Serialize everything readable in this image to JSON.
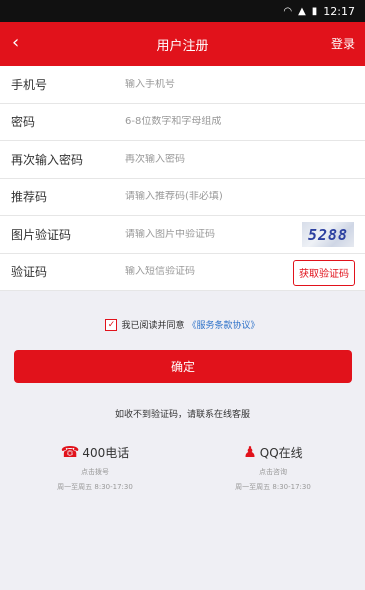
{
  "status_bar": {
    "time": "12:17",
    "icons": [
      "wifi-icon",
      "signal-icon",
      "battery-icon"
    ]
  },
  "nav": {
    "back": "‹",
    "title": "用户注册",
    "login": "登录"
  },
  "form": {
    "rows": [
      {
        "label": "手机号",
        "placeholder": "输入手机号"
      },
      {
        "label": "密码",
        "placeholder": "6-8位数字和字母组成"
      },
      {
        "label": "再次输入密码",
        "placeholder": "再次输入密码"
      },
      {
        "label": "推荐码",
        "placeholder": "请输入推荐码(非必填)"
      },
      {
        "label": "图片验证码",
        "placeholder": "请输入图片中验证码"
      },
      {
        "label": "验证码",
        "placeholder": "输入短信验证码"
      }
    ],
    "captcha_text": "5288",
    "get_code_label": "获取验证码"
  },
  "agreement": {
    "checked": true,
    "text": "我已阅读并同意",
    "link": "《服务条款协议》"
  },
  "confirm_label": "确定",
  "hint": "如收不到验证码，请联系在线客服",
  "contacts": [
    {
      "icon": "phone-icon",
      "title": "400电话",
      "sub": "点击拨号",
      "hours": "周一至周五 8:30-17:30"
    },
    {
      "icon": "qq-icon",
      "title": "QQ在线",
      "sub": "点击咨询",
      "hours": "周一至周五 8:30-17:30"
    }
  ],
  "colors": {
    "accent": "#e1121b",
    "link": "#2f73c9",
    "background": "#efeff4"
  }
}
